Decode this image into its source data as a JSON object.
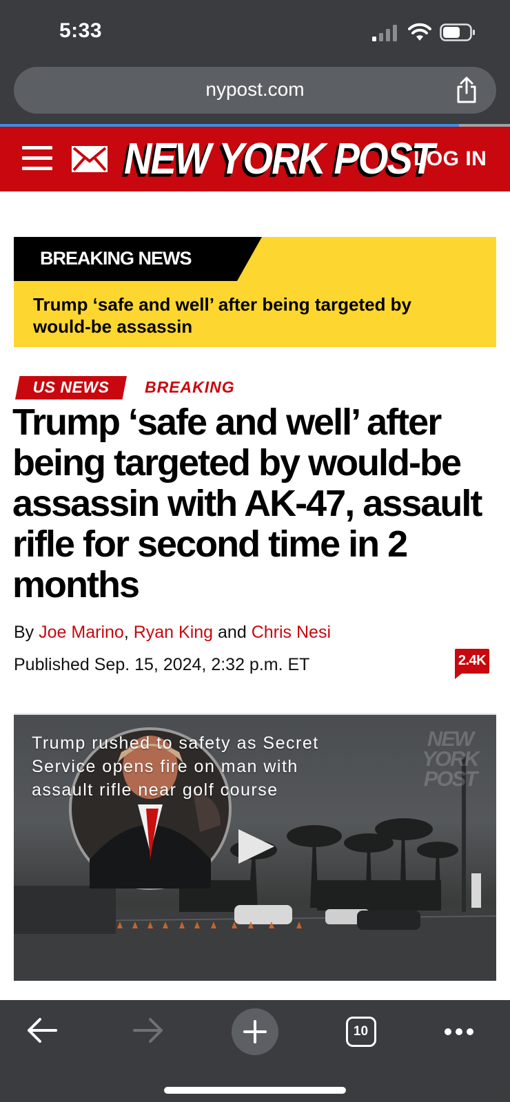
{
  "status_bar": {
    "time": "5:33",
    "icons": [
      "signal-icon",
      "wifi-icon",
      "battery-icon"
    ]
  },
  "browser": {
    "url": "nypost.com",
    "share_icon": "share-icon",
    "open_tabs": "10",
    "toolbar_icons": [
      "back-arrow-icon",
      "forward-arrow-icon",
      "plus-icon",
      "tabs-icon",
      "more-icon"
    ]
  },
  "site_header": {
    "logo_text": "NEW YORK POST",
    "login_label": "LOG IN",
    "menu_icon": "hamburger-menu-icon",
    "mail_icon": "mail-icon",
    "brand_color": "#c8080e"
  },
  "breaking_banner": {
    "label": "BREAKING NEWS",
    "headline": "Trump ‘safe and well’ after being targeted by would-be assassin",
    "color": "#fdd72f"
  },
  "article": {
    "tags": [
      "US NEWS",
      "BREAKING"
    ],
    "headline": "Trump ‘safe and well’ after being targeted by would-be assassin with AK-47, assault rifle for second time in 2 months",
    "byline_prefix": "By",
    "authors": [
      "Joe Marino",
      "Ryan King",
      "Chris Nesi"
    ],
    "author_separator": ",",
    "author_conjunction": "and",
    "published": "Published Sep. 15, 2024, 2:32 p.m. ET",
    "comment_count": "2.4K"
  },
  "video": {
    "caption": "Trump rushed to safety as Secret Service opens fire on man with assault rifle near golf course",
    "watermark": "NEW YORK POST",
    "play_icon": "play-icon"
  }
}
